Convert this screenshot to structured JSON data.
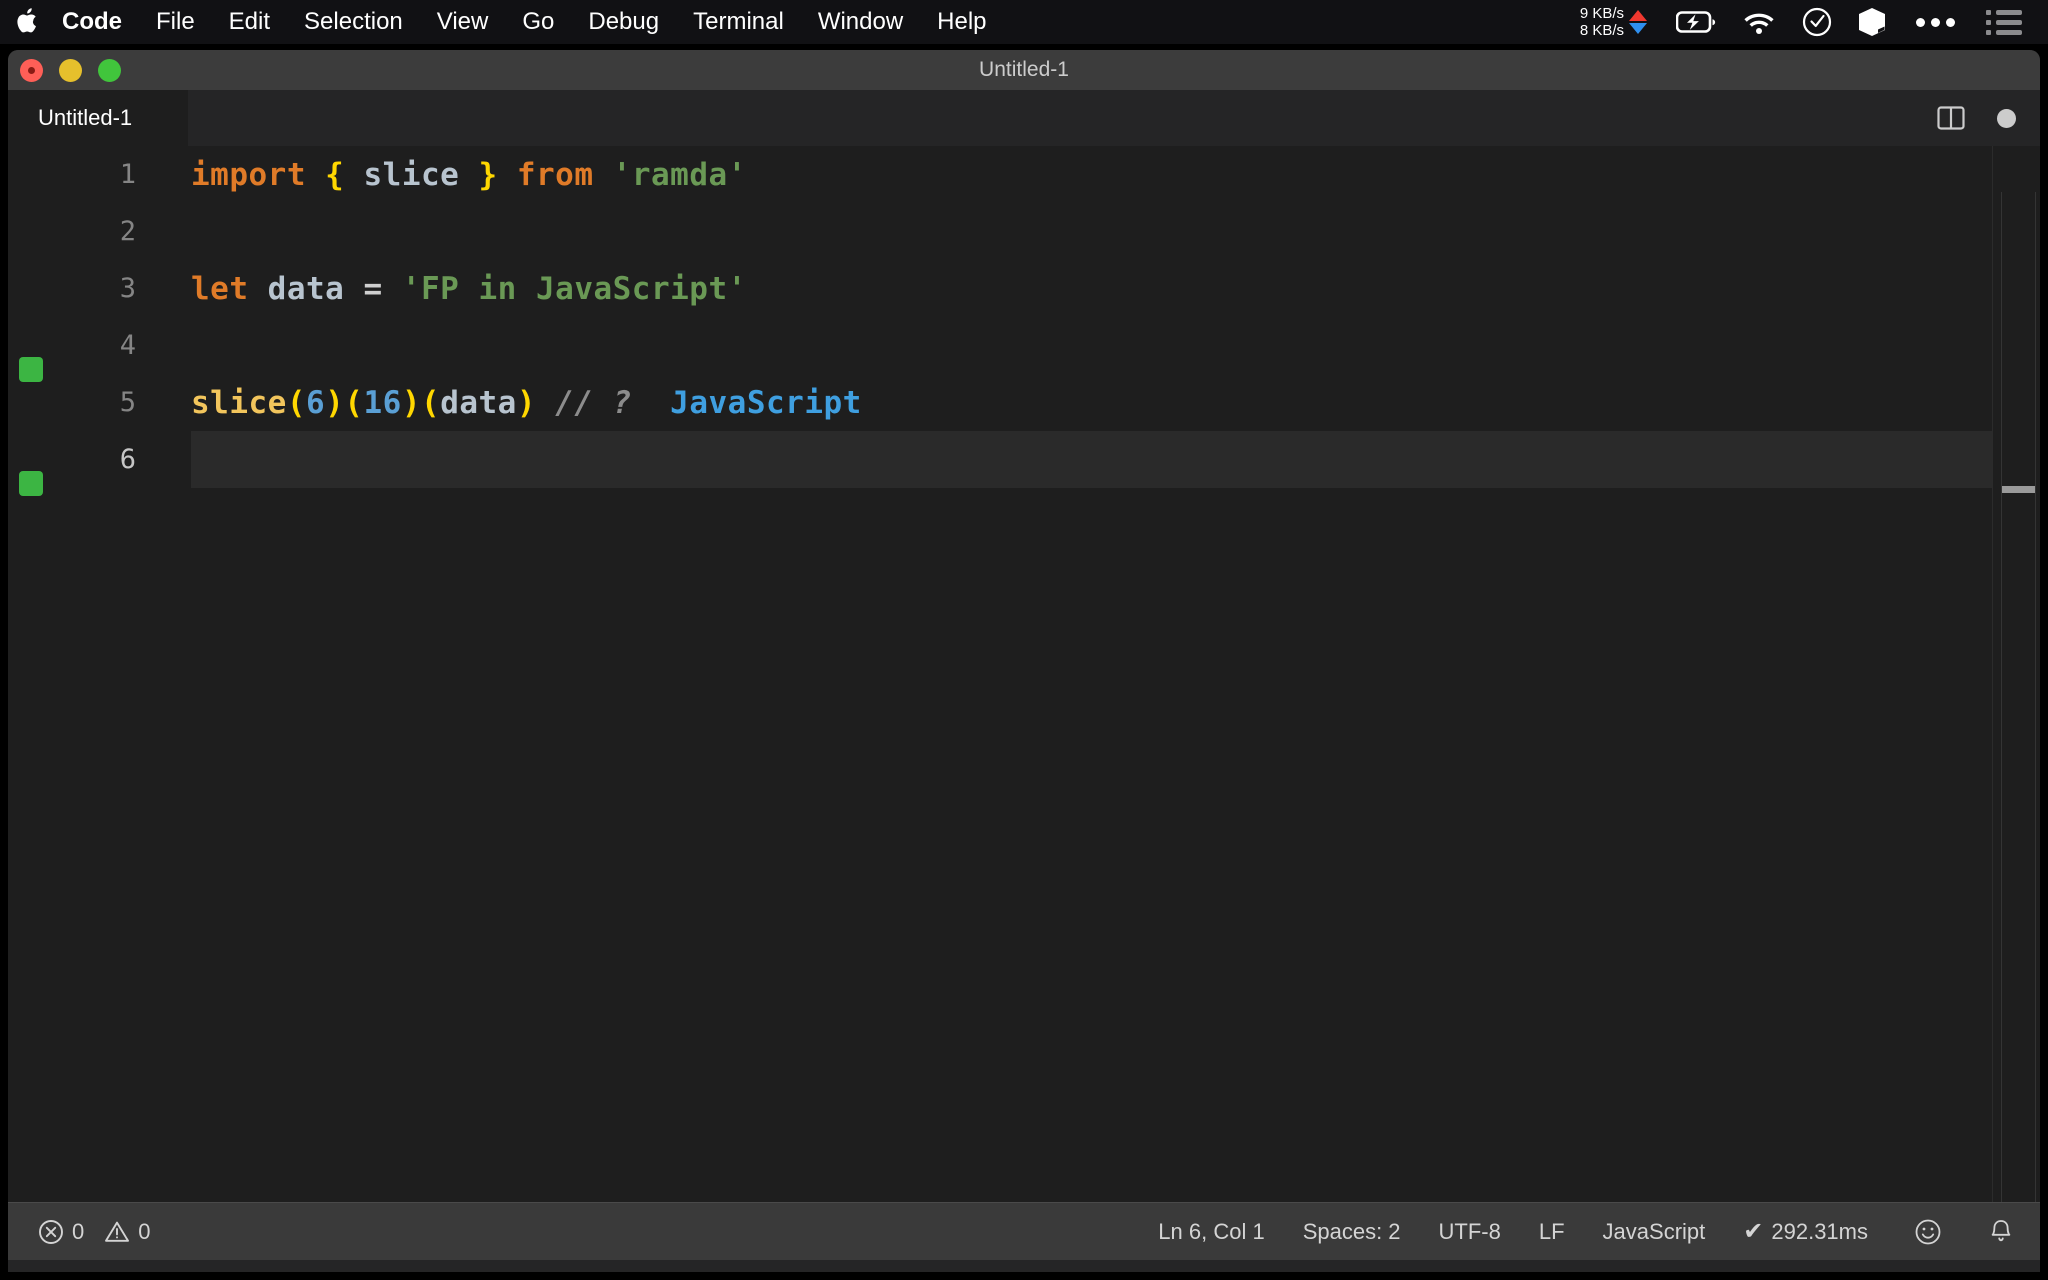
{
  "menubar": {
    "apple_icon": "apple-logo-icon",
    "items": [
      {
        "label": "Code",
        "bold": true
      },
      {
        "label": "File",
        "bold": false
      },
      {
        "label": "Edit",
        "bold": false
      },
      {
        "label": "Selection",
        "bold": false
      },
      {
        "label": "View",
        "bold": false
      },
      {
        "label": "Go",
        "bold": false
      },
      {
        "label": "Debug",
        "bold": false
      },
      {
        "label": "Terminal",
        "bold": false
      },
      {
        "label": "Window",
        "bold": false
      },
      {
        "label": "Help",
        "bold": false
      }
    ],
    "network": {
      "upload": "9 KB/s",
      "download": "8 KB/s",
      "upload_color": "#f0382f",
      "download_color": "#2f8fef"
    },
    "status_icons": [
      "battery-charging-icon",
      "wifi-icon",
      "clock-check-icon",
      "cube-icon",
      "ellipsis-icon",
      "control-center-list-icon"
    ]
  },
  "window": {
    "title": "Untitled-1",
    "traffic_lights": [
      "close-button",
      "minimize-button",
      "maximize-button"
    ]
  },
  "tabs": {
    "active": "Untitled-1",
    "actions": [
      "split-editor-icon",
      "unsaved-dirty-dot"
    ]
  },
  "editor": {
    "language_mode": "JavaScript",
    "coverage_marker_color": "#3cb543",
    "coverage_lines": [
      3,
      5
    ],
    "current_line": 6,
    "lines": [
      {
        "number": "1",
        "tokens": [
          {
            "t": "import",
            "c": "kw"
          },
          {
            "t": " ",
            "c": "op"
          },
          {
            "t": "{",
            "c": "brace"
          },
          {
            "t": " ",
            "c": "op"
          },
          {
            "t": "slice",
            "c": "ident"
          },
          {
            "t": " ",
            "c": "op"
          },
          {
            "t": "}",
            "c": "brace"
          },
          {
            "t": " ",
            "c": "op"
          },
          {
            "t": "from",
            "c": "kw"
          },
          {
            "t": " ",
            "c": "op"
          },
          {
            "t": "'ramda'",
            "c": "str"
          }
        ]
      },
      {
        "number": "2",
        "tokens": []
      },
      {
        "number": "3",
        "tokens": [
          {
            "t": "let",
            "c": "kw"
          },
          {
            "t": " ",
            "c": "op"
          },
          {
            "t": "data",
            "c": "ident"
          },
          {
            "t": " ",
            "c": "op"
          },
          {
            "t": "=",
            "c": "op"
          },
          {
            "t": " ",
            "c": "op"
          },
          {
            "t": "'FP in JavaScript'",
            "c": "str"
          }
        ]
      },
      {
        "number": "4",
        "tokens": []
      },
      {
        "number": "5",
        "tokens": [
          {
            "t": "slice",
            "c": "fn"
          },
          {
            "t": "(",
            "c": "brace"
          },
          {
            "t": "6",
            "c": "num"
          },
          {
            "t": ")",
            "c": "brace"
          },
          {
            "t": "(",
            "c": "brace"
          },
          {
            "t": "16",
            "c": "num"
          },
          {
            "t": ")",
            "c": "brace"
          },
          {
            "t": "(",
            "c": "brace"
          },
          {
            "t": "data",
            "c": "ident"
          },
          {
            "t": ")",
            "c": "brace"
          },
          {
            "t": " ",
            "c": "op"
          },
          {
            "t": "// ?",
            "c": "cmt"
          },
          {
            "t": "  ",
            "c": "op"
          },
          {
            "t": "JavaScript",
            "c": "inline-res"
          }
        ]
      },
      {
        "number": "6",
        "tokens": []
      }
    ]
  },
  "statusbar": {
    "errors": "0",
    "warnings": "0",
    "position": "Ln 6, Col 1",
    "indentation": "Spaces: 2",
    "encoding": "UTF-8",
    "eol": "LF",
    "language": "JavaScript",
    "runtime_check": "✔",
    "runtime": "292.31ms",
    "icons": [
      "smiley-feedback-icon",
      "bell-notifications-icon"
    ]
  }
}
